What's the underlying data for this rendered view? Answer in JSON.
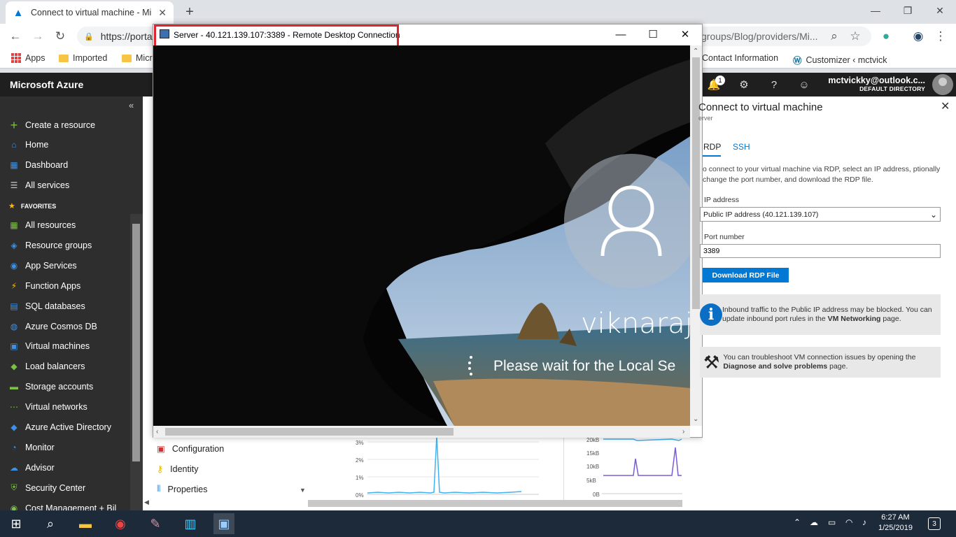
{
  "browser": {
    "tab_title": "Connect to virtual machine - Mic",
    "url_start": "https://porta",
    "url_end": "groups/Blog/providers/Mi...",
    "bookmarks": {
      "apps": "Apps",
      "imported": "Imported",
      "micro": "Micr",
      "contact": "Contact Information",
      "customizer": "Customizer ‹ mctvick"
    }
  },
  "azure": {
    "brand": "Microsoft Azure",
    "notification_count": "1",
    "account_email": "mctvickky@outlook.c...",
    "account_directory": "DEFAULT DIRECTORY"
  },
  "sidebar": {
    "create": "Create a resource",
    "home": "Home",
    "dashboard": "Dashboard",
    "all_services": "All services",
    "favorites": "FAVORITES",
    "items": [
      "All resources",
      "Resource groups",
      "App Services",
      "Function Apps",
      "SQL databases",
      "Azure Cosmos DB",
      "Virtual machines",
      "Load balancers",
      "Storage accounts",
      "Virtual networks",
      "Azure Active Directory",
      "Monitor",
      "Advisor",
      "Security Center",
      "Cost Management + Bil"
    ],
    "colors": [
      "#7cc242",
      "#3c91e6",
      "#3c91e6",
      "#ffb900",
      "#3c91e6",
      "#3c91e6",
      "#3c91e6",
      "#7cc242",
      "#7cc242",
      "#7cc242",
      "#3c91e6",
      "#3c91e6",
      "#3c91e6",
      "#7cc242",
      "#7cc242"
    ]
  },
  "subnav": {
    "configuration": "Configuration",
    "identity": "Identity",
    "properties": "Properties"
  },
  "charts": {
    "cpu_ticks": [
      "3%",
      "2%",
      "1%",
      "0%"
    ],
    "net_ticks": [
      "20kB",
      "15kB",
      "10kB",
      "5kB",
      "0B"
    ]
  },
  "rdp": {
    "title": "Server - 40.121.139.107:3389 - Remote Desktop Connection",
    "user": "viknaraj",
    "status": "Please wait for the Local Se"
  },
  "blade": {
    "title": "Connect to virtual machine",
    "subtitle": "erver",
    "tabs": [
      "RDP",
      "SSH"
    ],
    "description": "o connect to your virtual machine via RDP, select an IP address, ptionally change the port number, and download the RDP file.",
    "ip_label": "IP address",
    "ip_value": "Public IP address (40.121.139.107)",
    "port_label": "Port number",
    "port_value": "3389",
    "download_label": "Download RDP File",
    "info1_a": "Inbound traffic to the Public IP address may be blocked. You can update inbound port rules in the ",
    "info1_b": "VM Networking",
    "info1_c": " page.",
    "info2_a": "You can troubleshoot VM connection issues by opening the ",
    "info2_b": "Diagnose and solve problems",
    "info2_c": " page."
  },
  "taskbar": {
    "time": "6:27 AM",
    "date": "1/25/2019",
    "notifications": "3"
  }
}
